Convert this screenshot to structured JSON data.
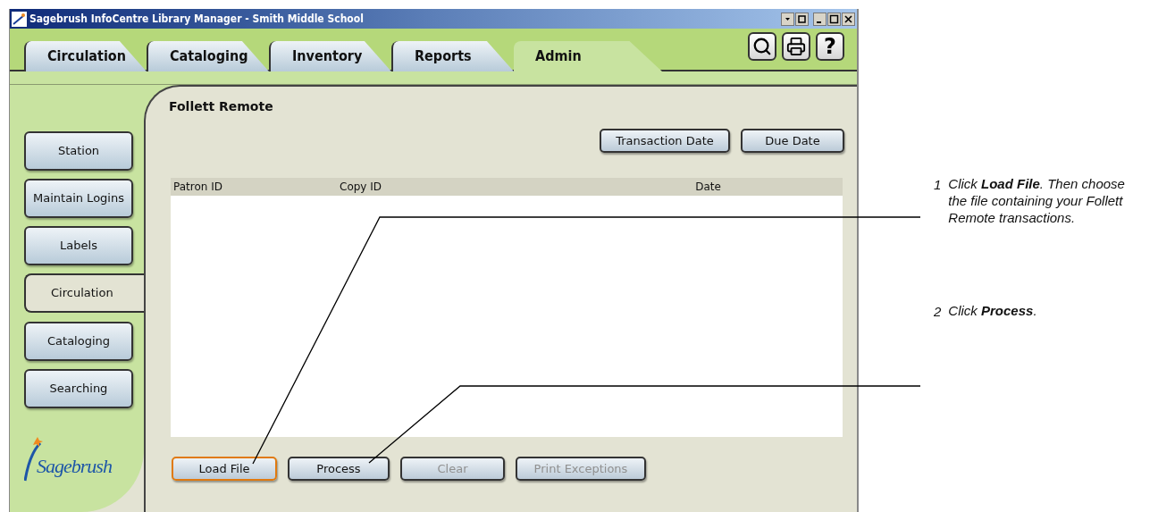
{
  "window": {
    "title": "Sagebrush InfoCentre Library Manager - Smith Middle School"
  },
  "tabs": [
    {
      "label": "Circulation",
      "selected": false
    },
    {
      "label": "Cataloging",
      "selected": false
    },
    {
      "label": "Inventory",
      "selected": false
    },
    {
      "label": "Reports",
      "selected": false
    },
    {
      "label": "Admin",
      "selected": true
    }
  ],
  "help_button": "?",
  "sidebar": {
    "items": [
      {
        "label": "Station",
        "selected": false
      },
      {
        "label": "Maintain Logins",
        "selected": false
      },
      {
        "label": "Labels",
        "selected": false
      },
      {
        "label": "Circulation",
        "selected": true
      },
      {
        "label": "Cataloging",
        "selected": false
      },
      {
        "label": "Searching",
        "selected": false
      }
    ],
    "logo": "Sagebrush"
  },
  "panel": {
    "title": "Follett Remote",
    "sort_buttons": [
      {
        "label": "Transaction Date",
        "disabled": false
      },
      {
        "label": "Due Date",
        "disabled": false
      }
    ],
    "table": {
      "columns": [
        "Patron ID",
        "Copy ID",
        "Date"
      ]
    },
    "buttons": [
      {
        "label": "Load File",
        "disabled": false,
        "focused": true
      },
      {
        "label": "Process",
        "disabled": false,
        "focused": false
      },
      {
        "label": "Clear",
        "disabled": true,
        "focused": false
      },
      {
        "label": "Print Exceptions",
        "disabled": true,
        "focused": false
      }
    ]
  },
  "callouts": [
    {
      "number": "1",
      "text": "Click **Load File**. Then choose the file containing your Follett Remote transactions."
    },
    {
      "number": "2",
      "text": "Click **Process**."
    }
  ]
}
